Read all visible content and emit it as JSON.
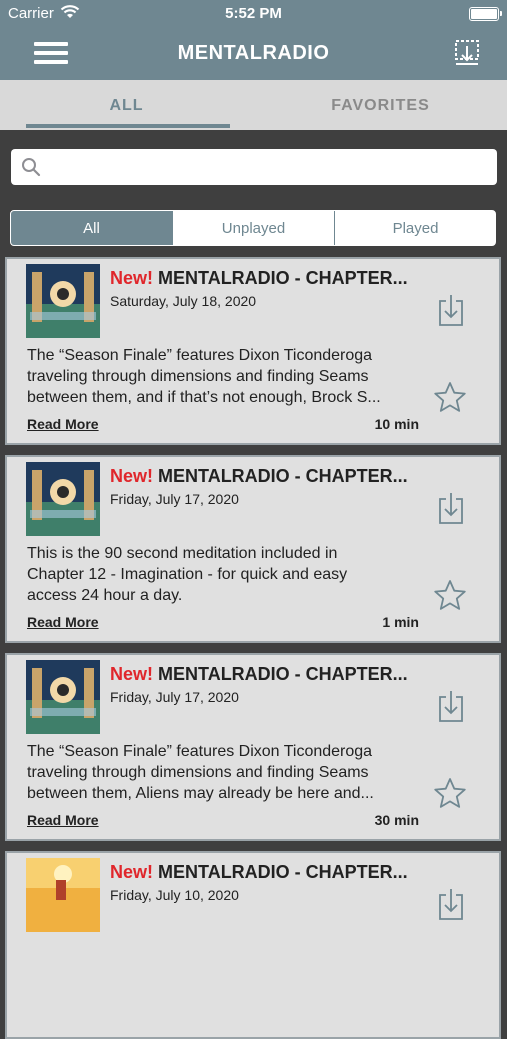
{
  "status_bar": {
    "carrier": "Carrier",
    "time": "5:52 PM"
  },
  "nav": {
    "title": "MENTALRADIO"
  },
  "tabs": [
    {
      "label": "ALL",
      "active": true
    },
    {
      "label": "FAVORITES",
      "active": false
    }
  ],
  "search": {
    "placeholder": "",
    "value": ""
  },
  "filter": {
    "options": [
      "All",
      "Unplayed",
      "Played"
    ],
    "selected": "All"
  },
  "colors": {
    "accent": "#6f8791",
    "new_badge": "#e0262b",
    "background": "#3f3f3f"
  },
  "episodes": [
    {
      "new_label": "New!",
      "title": "MENTALRADIO - CHAPTER...",
      "date": "Saturday, July 18, 2020",
      "description_lines": [
        "The “Season Finale” features Dixon Ticonderoga",
        "traveling through dimensions and finding Seams",
        "between them, and if that’s not enough, Brock S..."
      ],
      "read_more": "Read More",
      "duration": "10 min"
    },
    {
      "new_label": "New!",
      "title": "MENTALRADIO - CHAPTER...",
      "date": "Friday, July 17, 2020",
      "description_lines": [
        "This is the 90 second meditation included in",
        "Chapter 12 - Imagination - for quick and easy",
        "access 24 hour a day."
      ],
      "read_more": "Read More",
      "duration": "1 min"
    },
    {
      "new_label": "New!",
      "title": "MENTALRADIO - CHAPTER...",
      "date": "Friday, July 17, 2020",
      "description_lines": [
        "The “Season Finale” features Dixon Ticonderoga",
        "traveling through dimensions and finding Seams",
        "between them, Aliens may already be here and..."
      ],
      "read_more": "Read More",
      "duration": "30 min"
    },
    {
      "new_label": "New!",
      "title": "MENTALRADIO - CHAPTER...",
      "date": "Friday, July 10, 2020",
      "description_lines": [],
      "read_more": "",
      "duration": ""
    }
  ]
}
